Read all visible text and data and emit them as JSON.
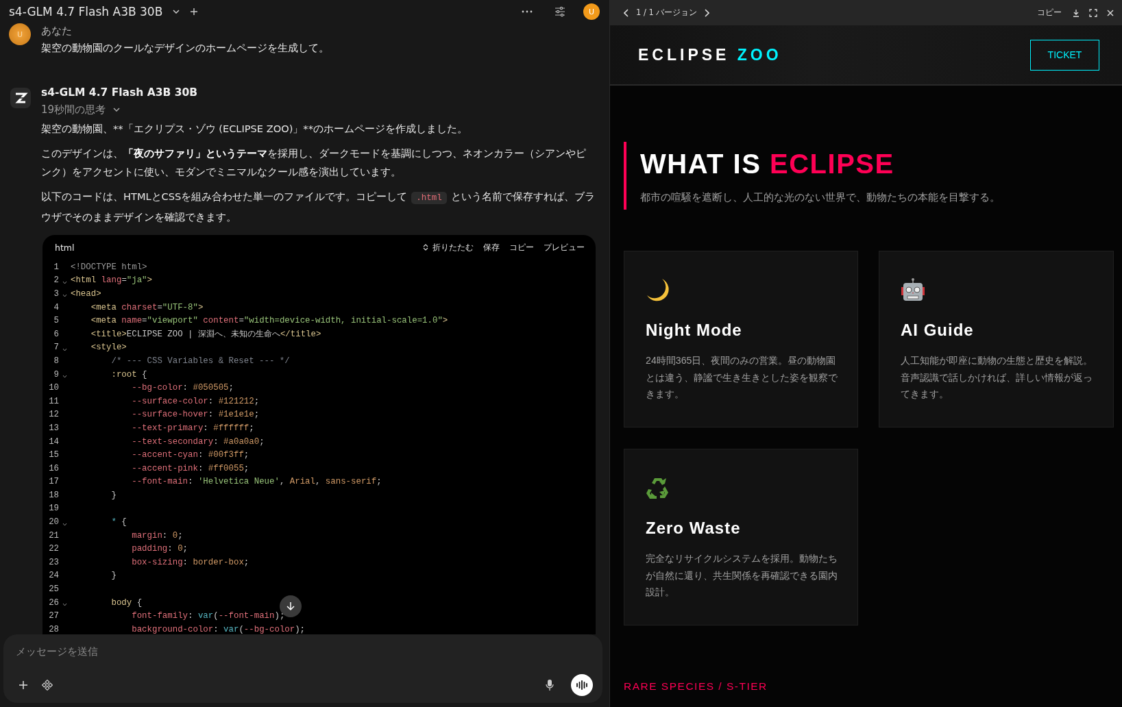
{
  "chat_header": {
    "model": "s4-GLM 4.7 Flash A3B 30B",
    "avatar": "U"
  },
  "user_message": {
    "author": "あなた",
    "avatar": "U",
    "text": "架空の動物園のクールなデザインのホームページを生成して。"
  },
  "assistant_message": {
    "model": "s4-GLM 4.7 Flash A3B 30B",
    "thinking": "19秒間の思考",
    "paragraphs": [
      {
        "kind": "plain",
        "text": "架空の動物園、**「エクリプス・ゾウ (ECLIPSE ZOO)」**のホームページを作成しました。"
      },
      {
        "kind": "rich",
        "text": "このデザインは、**「夜のサファリ」というテーマ**を採用し、ダークモードを基調にしつつ、ネオンカラー（シアンやピンク）をアクセントに使い、モダンでミニマルなクール感を演出しています。"
      },
      {
        "kind": "inline_code",
        "before": "以下のコードは、HTMLとCSSを組み合わせた単一のファイルです。コピーして",
        "code": ".html",
        "after": "という名前で保存すれば、ブラウザでそのままデザインを確認できます。"
      }
    ]
  },
  "code_block": {
    "language": "html",
    "actions": [
      "折りたたむ",
      "保存",
      "コピー",
      "プレビュー"
    ],
    "lines": [
      {
        "number": "1",
        "foldable": false,
        "tokens": [
          {
            "kind": "doctype",
            "text": "<!DOCTYPE html>"
          }
        ]
      },
      {
        "number": "2",
        "foldable": true,
        "tokens": [
          {
            "kind": "tag",
            "text": "<html"
          },
          {
            "kind": "attr",
            "text": " lang"
          },
          {
            "kind": "plain",
            "text": "="
          },
          {
            "kind": "str",
            "text": "\"ja\""
          },
          {
            "kind": "tag",
            "text": ">"
          }
        ]
      },
      {
        "number": "3",
        "foldable": true,
        "tokens": [
          {
            "kind": "tag",
            "text": "<head>"
          }
        ]
      },
      {
        "number": "4",
        "foldable": false,
        "tokens": [
          {
            "kind": "tag",
            "text": "    <meta"
          },
          {
            "kind": "attr",
            "text": " charset"
          },
          {
            "kind": "plain",
            "text": "="
          },
          {
            "kind": "str",
            "text": "\"UTF-8\""
          },
          {
            "kind": "tag",
            "text": ">"
          }
        ]
      },
      {
        "number": "5",
        "foldable": false,
        "tokens": [
          {
            "kind": "tag",
            "text": "    <meta"
          },
          {
            "kind": "attr",
            "text": " name"
          },
          {
            "kind": "plain",
            "text": "="
          },
          {
            "kind": "str",
            "text": "\"viewport\""
          },
          {
            "kind": "attr",
            "text": " content"
          },
          {
            "kind": "plain",
            "text": "="
          },
          {
            "kind": "str",
            "text": "\"width=device-width, initial-scale=1.0\""
          },
          {
            "kind": "tag",
            "text": ">"
          }
        ]
      },
      {
        "number": "6",
        "foldable": false,
        "tokens": [
          {
            "kind": "tag",
            "text": "    <title>"
          },
          {
            "kind": "plain",
            "text": "ECLIPSE ZOO | 深淵へ、未知の生命へ"
          },
          {
            "kind": "tag",
            "text": "</title>"
          }
        ]
      },
      {
        "number": "7",
        "foldable": true,
        "tokens": [
          {
            "kind": "tag",
            "text": "    <style>"
          }
        ]
      },
      {
        "number": "8",
        "foldable": false,
        "tokens": [
          {
            "kind": "comment",
            "text": "        /* --- CSS Variables & Reset --- */"
          }
        ]
      },
      {
        "number": "9",
        "foldable": true,
        "tokens": [
          {
            "kind": "tag",
            "text": "        :root"
          },
          {
            "kind": "plain",
            "text": " {"
          }
        ]
      },
      {
        "number": "10",
        "foldable": false,
        "tokens": [
          {
            "kind": "attr",
            "text": "            --bg-color"
          },
          {
            "kind": "plain",
            "text": ": "
          },
          {
            "kind": "val",
            "text": "#050505"
          },
          {
            "kind": "plain",
            "text": ";"
          }
        ]
      },
      {
        "number": "11",
        "foldable": false,
        "tokens": [
          {
            "kind": "attr",
            "text": "            --surface-color"
          },
          {
            "kind": "plain",
            "text": ": "
          },
          {
            "kind": "val",
            "text": "#121212"
          },
          {
            "kind": "plain",
            "text": ";"
          }
        ]
      },
      {
        "number": "12",
        "foldable": false,
        "tokens": [
          {
            "kind": "attr",
            "text": "            --surface-hover"
          },
          {
            "kind": "plain",
            "text": ": "
          },
          {
            "kind": "val",
            "text": "#1e1e1e"
          },
          {
            "kind": "plain",
            "text": ";"
          }
        ]
      },
      {
        "number": "13",
        "foldable": false,
        "tokens": [
          {
            "kind": "attr",
            "text": "            --text-primary"
          },
          {
            "kind": "plain",
            "text": ": "
          },
          {
            "kind": "val",
            "text": "#ffffff"
          },
          {
            "kind": "plain",
            "text": ";"
          }
        ]
      },
      {
        "number": "14",
        "foldable": false,
        "tokens": [
          {
            "kind": "attr",
            "text": "            --text-secondary"
          },
          {
            "kind": "plain",
            "text": ": "
          },
          {
            "kind": "val",
            "text": "#a0a0a0"
          },
          {
            "kind": "plain",
            "text": ";"
          }
        ]
      },
      {
        "number": "15",
        "foldable": false,
        "tokens": [
          {
            "kind": "attr",
            "text": "            --accent-cyan"
          },
          {
            "kind": "plain",
            "text": ": "
          },
          {
            "kind": "val",
            "text": "#00f3ff"
          },
          {
            "kind": "plain",
            "text": ";"
          }
        ]
      },
      {
        "number": "16",
        "foldable": false,
        "tokens": [
          {
            "kind": "attr",
            "text": "            --accent-pink"
          },
          {
            "kind": "plain",
            "text": ": "
          },
          {
            "kind": "val",
            "text": "#ff0055"
          },
          {
            "kind": "plain",
            "text": ";"
          }
        ]
      },
      {
        "number": "17",
        "foldable": false,
        "tokens": [
          {
            "kind": "attr",
            "text": "            --font-main"
          },
          {
            "kind": "plain",
            "text": ": "
          },
          {
            "kind": "str",
            "text": "'Helvetica Neue'"
          },
          {
            "kind": "plain",
            "text": ", "
          },
          {
            "kind": "val",
            "text": "Arial"
          },
          {
            "kind": "plain",
            "text": ", "
          },
          {
            "kind": "val",
            "text": "sans-serif"
          },
          {
            "kind": "plain",
            "text": ";"
          }
        ]
      },
      {
        "number": "18",
        "foldable": false,
        "tokens": [
          {
            "kind": "plain",
            "text": "        }"
          }
        ]
      },
      {
        "number": "19",
        "foldable": false
      },
      {
        "number": "20",
        "foldable": true,
        "tokens": [
          {
            "kind": "fn",
            "text": "        *"
          },
          {
            "kind": "plain",
            "text": " {"
          }
        ]
      },
      {
        "number": "21",
        "foldable": false,
        "tokens": [
          {
            "kind": "attr",
            "text": "            margin"
          },
          {
            "kind": "plain",
            "text": ": "
          },
          {
            "kind": "val",
            "text": "0"
          },
          {
            "kind": "plain",
            "text": ";"
          }
        ]
      },
      {
        "number": "22",
        "foldable": false,
        "tokens": [
          {
            "kind": "attr",
            "text": "            padding"
          },
          {
            "kind": "plain",
            "text": ": "
          },
          {
            "kind": "val",
            "text": "0"
          },
          {
            "kind": "plain",
            "text": ";"
          }
        ]
      },
      {
        "number": "23",
        "foldable": false,
        "tokens": [
          {
            "kind": "attr",
            "text": "            box-sizing"
          },
          {
            "kind": "plain",
            "text": ": "
          },
          {
            "kind": "val",
            "text": "border-box"
          },
          {
            "kind": "plain",
            "text": ";"
          }
        ]
      },
      {
        "number": "24",
        "foldable": false,
        "tokens": [
          {
            "kind": "plain",
            "text": "        }"
          }
        ]
      },
      {
        "number": "25",
        "foldable": false
      },
      {
        "number": "26",
        "foldable": true,
        "tokens": [
          {
            "kind": "tag",
            "text": "        body"
          },
          {
            "kind": "plain",
            "text": " {"
          }
        ]
      },
      {
        "number": "27",
        "foldable": false,
        "tokens": [
          {
            "kind": "attr",
            "text": "            font-family"
          },
          {
            "kind": "plain",
            "text": ": "
          },
          {
            "kind": "fn",
            "text": "var"
          },
          {
            "kind": "plain",
            "text": "("
          },
          {
            "kind": "attr",
            "text": "--font-main"
          },
          {
            "kind": "plain",
            "text": ");"
          }
        ]
      },
      {
        "number": "28",
        "foldable": false,
        "tokens": [
          {
            "kind": "attr",
            "text": "            background-color"
          },
          {
            "kind": "plain",
            "text": ": "
          },
          {
            "kind": "fn",
            "text": "var"
          },
          {
            "kind": "plain",
            "text": "("
          },
          {
            "kind": "attr",
            "text": "--bg-color"
          },
          {
            "kind": "plain",
            "text": ");"
          }
        ]
      }
    ]
  },
  "composer": {
    "placeholder": "メッセージを送信"
  },
  "preview_bar": {
    "version": "1 / 1 バージョン",
    "copy": "コピー"
  },
  "site": {
    "logo": {
      "text": "ECLIPSE",
      "accent": "ZOO"
    },
    "ticket": "TICKET",
    "hero": {
      "title": "WHAT IS",
      "accent": "ECLIPSE",
      "subtitle": "都市の喧騒を遮断し、人工的な光のない世界で、動物たちの本能を目撃する。"
    },
    "cards": [
      {
        "title": "Night Mode",
        "text": "24時間365日、夜間のみの営業。昼の動物園とは違う、静謐で生き生きとした姿を観察できます。"
      },
      {
        "title": "AI Guide",
        "text": "人工知能が即座に動物の生態と歴史を解説。音声認識で話しかければ、詳しい情報が返ってきます。"
      },
      {
        "title": "Zero Waste",
        "text": "完全なリサイクルシステムを採用。動物たちが自然に還り、共生関係を再確認できる園内設計。"
      }
    ],
    "section_label": "RARE SPECIES / S-TIER"
  }
}
